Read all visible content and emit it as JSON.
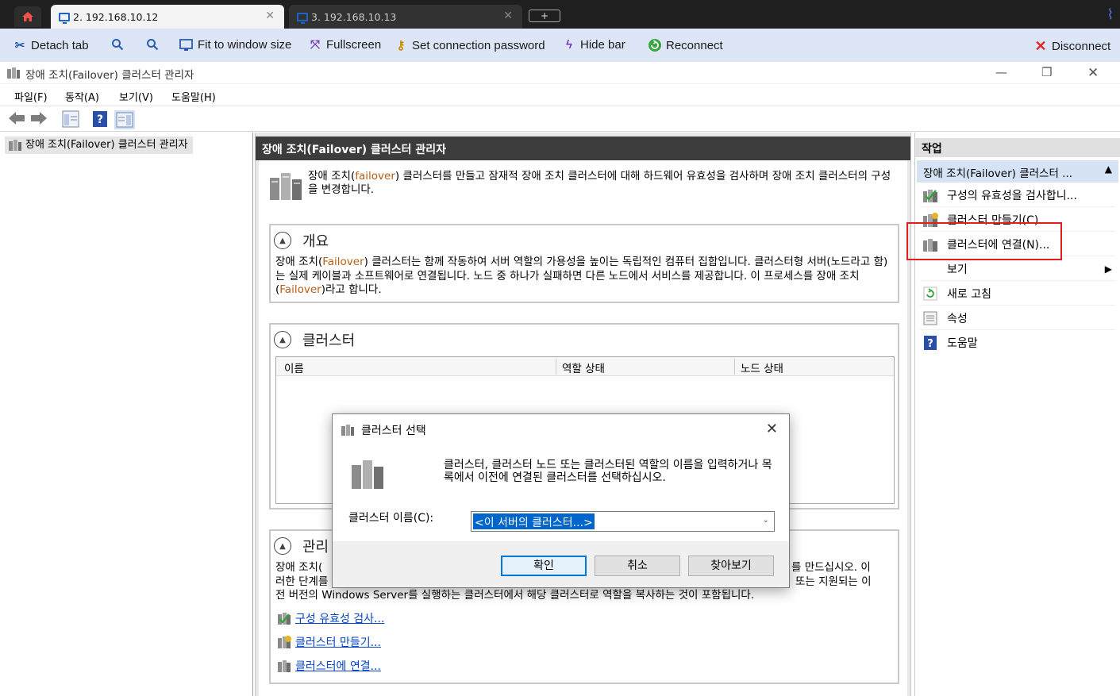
{
  "browser": {
    "tabs": [
      {
        "label": "2. 192.168.10.12",
        "active": true
      },
      {
        "label": "3. 192.168.10.13",
        "active": false
      }
    ],
    "new_tab_label": "+"
  },
  "conn_toolbar": {
    "detach": "Detach tab",
    "fit": "Fit to window size",
    "fullscreen": "Fullscreen",
    "set_password": "Set connection password",
    "hide_bar": "Hide bar",
    "reconnect": "Reconnect",
    "disconnect": "Disconnect"
  },
  "window": {
    "title": "장애 조치(Failover) 클러스터 관리자"
  },
  "menu": {
    "file": "파일(F)",
    "action": "동작(A)",
    "view": "보기(V)",
    "help": "도움말(H)"
  },
  "tree": {
    "root": "장애 조치(Failover) 클러스터 관리자"
  },
  "center": {
    "header": "장애 조치(Failover) 클러스터 관리자",
    "intro": {
      "p1": "장애 조치(",
      "p2": "failover",
      "p3": ") 클러스터를 만들고 잠재적 장애 조치 클러스터에 대해 하드웨어 유효성을 검사하며 장애 조치 클러스터의 구성을 변경합니다."
    },
    "overview": {
      "title": "개요",
      "t1": "장애 조치(",
      "t2": "Failover",
      "t3": ") 클러스터는 함께 작동하여 서버 역할의 가용성을 높이는 독립적인 컴퓨터 집합입니다. 클러스터형 서버(노드라고 함)는 실제 케이블과 소프트웨어로 연결됩니다. 노드 중 하나가 실패하면 다른 노드에서 서비스를 제공합니다. 이 프로세스를 장애 조치(",
      "t4": "Failover",
      "t5": ")라고 합니다."
    },
    "clusters": {
      "title": "클러스터",
      "columns": [
        "이름",
        "역할 상태",
        "노드 상태"
      ]
    },
    "manage": {
      "title": "관리",
      "line1_left": "장애 조치(",
      "line1_right": "를 만드십시오. 이",
      "line2_left": "러한 단계를",
      "line2_right": "또는 지원되는 이",
      "line3": "전 버전의 Windows Server를 실행하는 클러스터에서 해당 클러스터로 역할을 복사하는 것이 포함됩니다.",
      "links": [
        "구성 유효성 검사...",
        "클러스터 만들기...",
        "클러스터에 연결..."
      ]
    }
  },
  "actions": {
    "header": "작업",
    "group": "장애 조치(Failover) 클러스터 ...",
    "items": [
      {
        "label": "구성의 유효성을 검사합니...",
        "icon": "validate-icon"
      },
      {
        "label": "클러스터 만들기(C)...",
        "icon": "create-cluster-icon"
      },
      {
        "label": "클러스터에 연결(N)...",
        "icon": "connect-cluster-icon"
      },
      {
        "label": "보기",
        "icon": "none"
      },
      {
        "label": "새로 고침",
        "icon": "refresh-icon"
      },
      {
        "label": "속성",
        "icon": "properties-icon"
      },
      {
        "label": "도움말",
        "icon": "help-icon"
      }
    ]
  },
  "dialog": {
    "title": "클러스터 선택",
    "description": "클러스터, 클러스터 노드 또는 클러스터된 역할의 이름을 입력하거나 목록에서 이전에 연결된 클러스터를 선택하십시오.",
    "label": "클러스터 이름(C):",
    "combo_value": "<이 서버의 클러스터...>",
    "ok": "확인",
    "cancel": "취소",
    "browse": "찾아보기"
  },
  "colors": {
    "accent_blue": "#0078d7",
    "link_blue": "#0645c4",
    "highlight_red": "#e02020",
    "failover_orange": "#b85e14"
  }
}
